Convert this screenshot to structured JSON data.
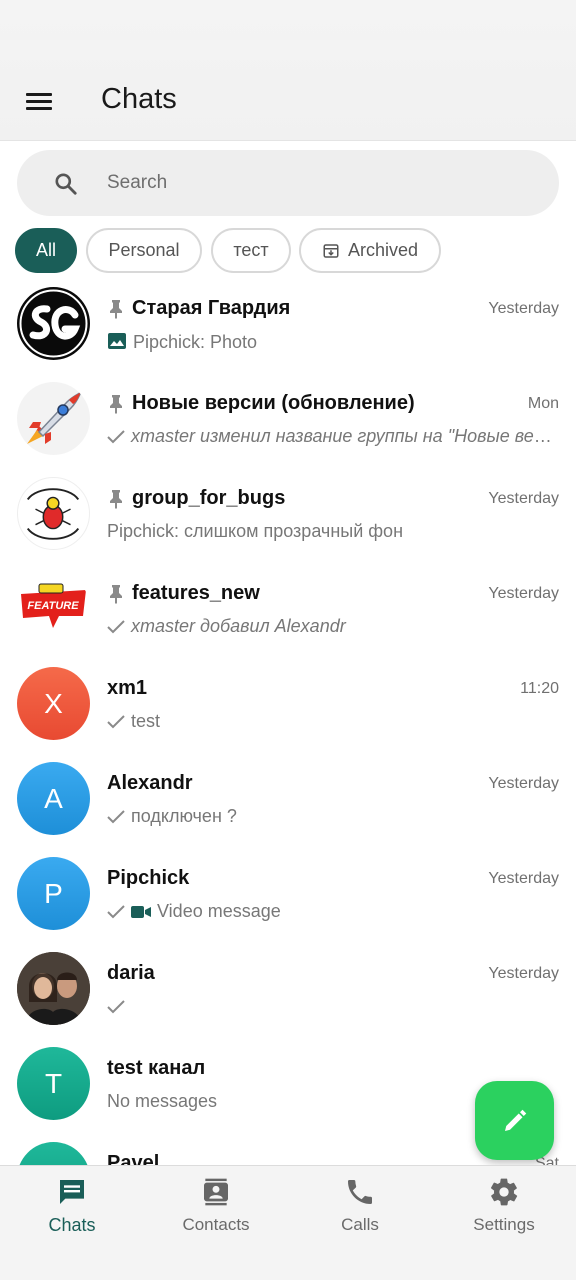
{
  "header": {
    "title": "Chats"
  },
  "search": {
    "placeholder": "Search"
  },
  "filters": [
    {
      "label": "All",
      "active": true
    },
    {
      "label": "Personal",
      "active": false
    },
    {
      "label": "тест",
      "active": false
    },
    {
      "label": "Archived",
      "active": false
    }
  ],
  "chats": [
    {
      "name": "Старая Гвардия",
      "time": "Yesterday",
      "preview": "Pipchick: Photo",
      "pinned": true,
      "avatar": "SG-logo"
    },
    {
      "name": "Новые версии (обновление)",
      "time": "Mon",
      "preview": "xmaster изменил название группы на \"Новые версии (обновление)\"",
      "pinned": true,
      "avatar": "rocket"
    },
    {
      "name": "group_for_bugs",
      "time": "Yesterday",
      "preview": "Pipchick: слишком прозрачный фон",
      "pinned": true,
      "avatar": "Fix It Now Or Delete It"
    },
    {
      "name": "features_new",
      "time": "Yesterday",
      "preview": "xmaster добавил Alexandr",
      "pinned": true,
      "avatar": "FEATURE"
    },
    {
      "name": "xm1",
      "time": "11:20",
      "preview": "test",
      "pinned": false,
      "letter": "X"
    },
    {
      "name": "Alexandr",
      "time": "Yesterday",
      "preview": "подключен ?",
      "pinned": false,
      "letter": "A"
    },
    {
      "name": "Pipchick",
      "time": "Yesterday",
      "preview": "Video message",
      "pinned": false,
      "letter": "P"
    },
    {
      "name": "daria",
      "time": "Yesterday",
      "preview": "",
      "pinned": false,
      "avatar": "photo"
    },
    {
      "name": "test канал",
      "time": "",
      "preview": "No messages",
      "pinned": false,
      "letter": "T"
    },
    {
      "name": "Pavel",
      "time": "Sat",
      "preview": "",
      "pinned": false,
      "letter": ""
    }
  ],
  "nav": {
    "chats": "Chats",
    "contacts": "Contacts",
    "calls": "Calls",
    "settings": "Settings"
  },
  "colors": {
    "accent": "#1a5e58",
    "fab": "#2bd15f",
    "avatar_x": "#f2553c",
    "avatar_a": "#2a9fe0",
    "avatar_p": "#2a9fe0",
    "avatar_t": "#14a88c"
  }
}
